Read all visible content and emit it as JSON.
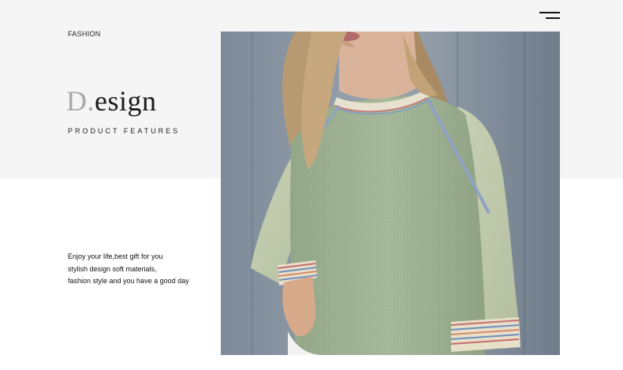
{
  "header": {
    "section_label": "FASHION",
    "menu_icon": "hamburger-menu-icon"
  },
  "hero": {
    "title_initial": "D.",
    "title_rest": "esign",
    "subtitle": "PRODUCT FEATURES"
  },
  "description": {
    "lines": [
      "Enjoy your life,best gift for you",
      "stylish design soft materials,",
      "fashion style and you have a good day"
    ]
  },
  "colors": {
    "band_background": "#f5f5f5",
    "page_background": "#ffffff",
    "title_initial": "#a9a9a9",
    "text": "#111111"
  }
}
